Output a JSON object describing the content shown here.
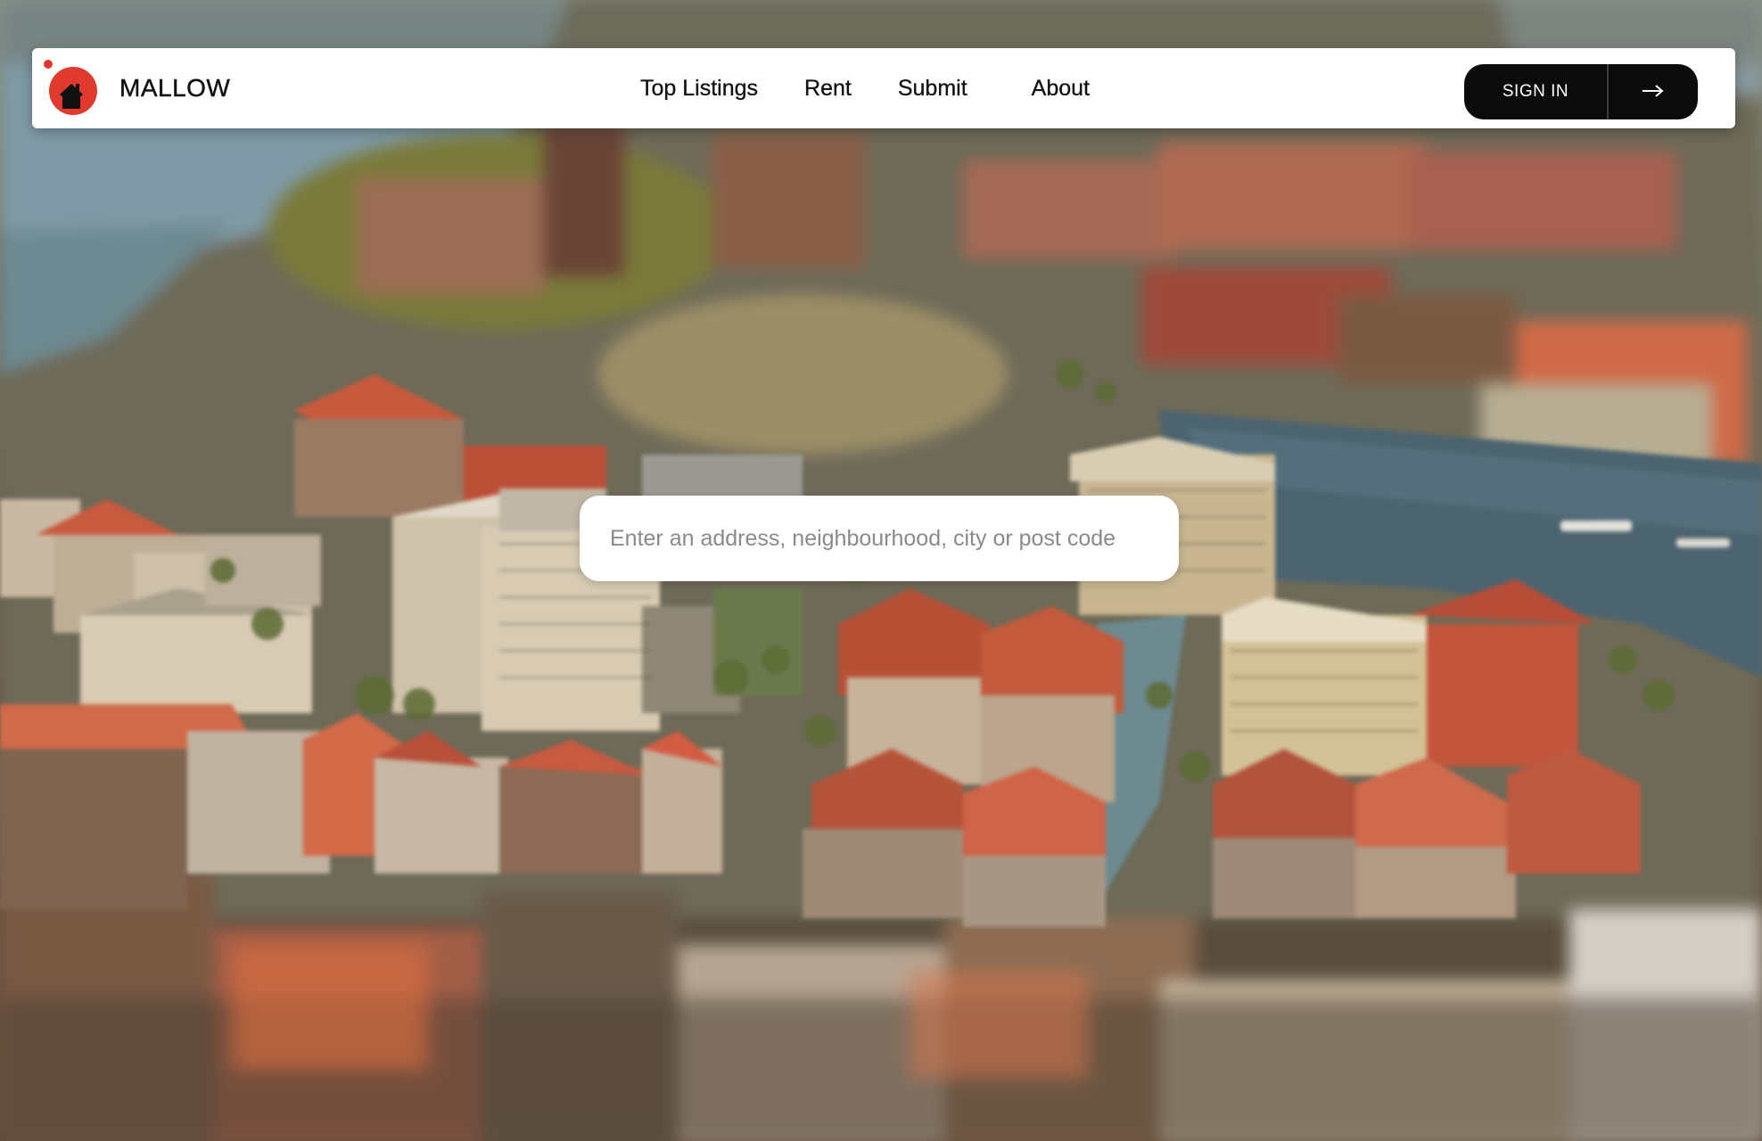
{
  "brand": {
    "name": "MALLOW",
    "logo_icon": "house-in-red-circle-icon",
    "accent_color": "#e03a2f"
  },
  "nav": {
    "links": [
      {
        "label": "Top Listings"
      },
      {
        "label": "Rent"
      },
      {
        "label": "Submit"
      },
      {
        "label": "About"
      }
    ]
  },
  "auth": {
    "sign_in_label": "SIGN IN",
    "arrow_icon": "arrow-right-icon",
    "button_color": "#0b0b0b"
  },
  "search": {
    "placeholder": "Enter an address, neighbourhood, city or post code",
    "value": ""
  },
  "background": {
    "image": "blurred-miniature-city-model"
  }
}
